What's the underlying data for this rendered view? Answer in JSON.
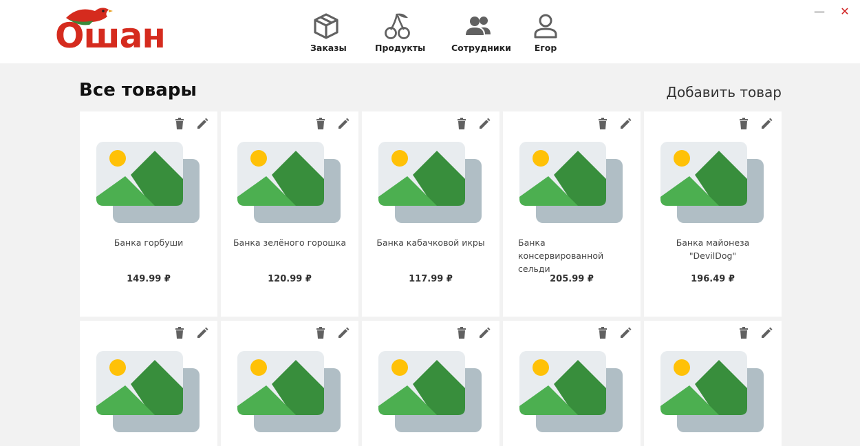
{
  "app": {
    "logo_text": "Ошан",
    "window_controls": {
      "minimize": "—",
      "close": "✕"
    }
  },
  "nav": {
    "items": [
      {
        "label": "Заказы",
        "icon": "box-icon"
      },
      {
        "label": "Продукты",
        "icon": "cherry-icon"
      },
      {
        "label": "Сотрудники",
        "icon": "users-icon"
      },
      {
        "label": "Егор",
        "icon": "user-icon"
      }
    ]
  },
  "main": {
    "title": "Все товары",
    "add_label": "Добавить товар",
    "products": [
      {
        "name": "Банка горбуши",
        "price": "149.99 ₽"
      },
      {
        "name": "Банка зелёного горошка",
        "price": "120.99 ₽"
      },
      {
        "name": "Банка кабачковой икры",
        "price": "117.99 ₽"
      },
      {
        "name": "Банка консервированной сельди",
        "price": "205.99 ₽"
      },
      {
        "name": "Банка майонеза \"DevilDog\"",
        "price": "196.49 ₽"
      },
      {
        "name": "",
        "price": ""
      },
      {
        "name": "",
        "price": ""
      },
      {
        "name": "",
        "price": ""
      },
      {
        "name": "",
        "price": ""
      },
      {
        "name": "",
        "price": ""
      }
    ]
  },
  "colors": {
    "brand_red": "#d52b1e",
    "background": "#f2f2f2",
    "card": "#ffffff",
    "icon_gray": "#616161"
  }
}
